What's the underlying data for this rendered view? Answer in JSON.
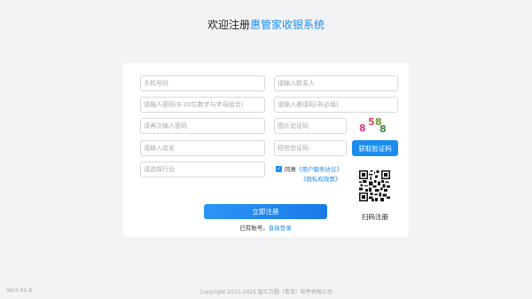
{
  "header": {
    "title_prefix": "欢迎注册",
    "title_brand": "惠管家收银系统"
  },
  "form": {
    "phone_placeholder": "手机号码",
    "contact_placeholder": "请输入联系人",
    "password_placeholder": "请输入密码(8-20位数字与字母组合)",
    "invite_placeholder": "请输入邀请码(非必填)",
    "confirm_password_placeholder": "请再次输入密码",
    "image_code_placeholder": "图片验证码",
    "store_name_placeholder": "请输入店名",
    "sms_code_placeholder": "短信验证码",
    "industry_placeholder": "请选择行业",
    "captcha": {
      "d1": "8",
      "d2": "5",
      "d3": "8",
      "d4": "8"
    },
    "sms_button": "获取验证码",
    "agree_prefix": "同意",
    "agreement_link": "《用户服务协议》",
    "privacy_link": "《隐私权政策》",
    "submit_button": "立即注册",
    "has_account": "已有账号，",
    "login_link": "直接登录"
  },
  "qr": {
    "label": "扫码注册"
  },
  "footer": {
    "version": "Ver3.91.8",
    "copyright": "Copyright 2015-2025 智汇方圆（青岛）软件有限公司"
  },
  "colors": {
    "accent": "#1a8cf0",
    "background": "#f2f3f5"
  }
}
